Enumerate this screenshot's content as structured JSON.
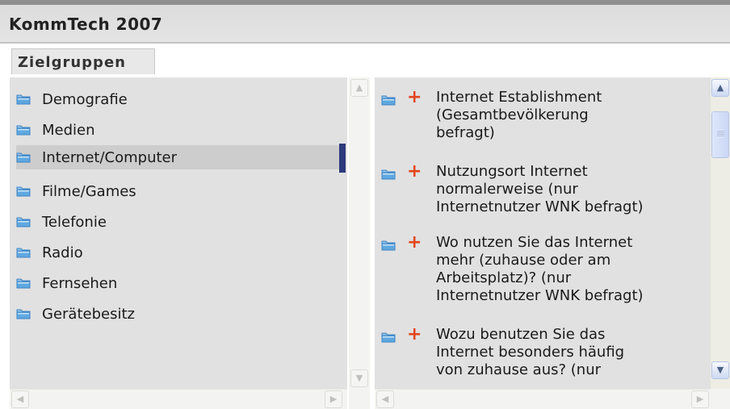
{
  "app": {
    "title": "KommTech 2007"
  },
  "tabs": [
    {
      "label": "Zielgruppen"
    }
  ],
  "categories": [
    {
      "label": "Demografie"
    },
    {
      "label": "Medien"
    },
    {
      "label": "Internet/Computer",
      "selected": true
    },
    {
      "label": "Filme/Games"
    },
    {
      "label": "Telefonie"
    },
    {
      "label": "Radio"
    },
    {
      "label": "Fernsehen"
    },
    {
      "label": "Gerätebesitz"
    }
  ],
  "questions": [
    {
      "lines": [
        "Internet Establishment",
        "(Gesamtbevölkerung",
        "befragt)"
      ]
    },
    {
      "lines": [
        "Nutzungsort Internet",
        "normalerweise (nur",
        "Internetnutzer WNK befragt)"
      ]
    },
    {
      "lines": [
        "Wo nutzen Sie das Internet",
        "mehr (zuhause oder am",
        "Arbeitsplatz)? (nur",
        "Internetnutzer WNK befragt)"
      ]
    },
    {
      "lines": [
        "Wozu benutzen Sie das",
        "Internet besonders häufig",
        "von zuhause aus? (nur"
      ]
    }
  ],
  "icons": {
    "folder": "folder-icon",
    "add": "plus-icon"
  },
  "colors": {
    "folder": "#5fa8e0",
    "plus": "#e2451c",
    "selection_marker": "#2d3a7c"
  }
}
